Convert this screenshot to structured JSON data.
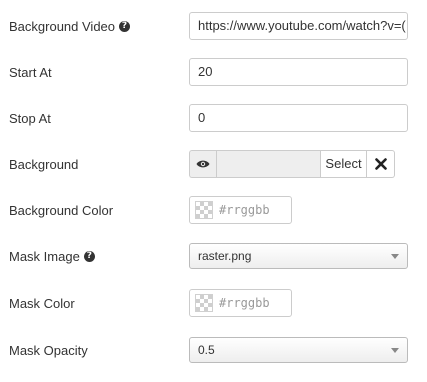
{
  "fields": {
    "background_video": {
      "label": "Background Video",
      "value": "https://www.youtube.com/watch?v=("
    },
    "start_at": {
      "label": "Start At",
      "value": "20"
    },
    "stop_at": {
      "label": "Stop At",
      "value": "0"
    },
    "background": {
      "label": "Background",
      "preview_icon": "eye-icon",
      "select_label": "Select",
      "clear_icon": "close-icon"
    },
    "background_color": {
      "label": "Background Color",
      "placeholder": "#rrggbb"
    },
    "mask_image": {
      "label": "Mask Image",
      "selected": "raster.png"
    },
    "mask_color": {
      "label": "Mask Color",
      "placeholder": "#rrggbb"
    },
    "mask_opacity": {
      "label": "Mask Opacity",
      "selected": "0.5"
    }
  },
  "icons": {
    "help": "question-circle-icon"
  },
  "colors": {
    "text": "#333333",
    "border": "#cccccc",
    "placeholder": "#999999"
  }
}
